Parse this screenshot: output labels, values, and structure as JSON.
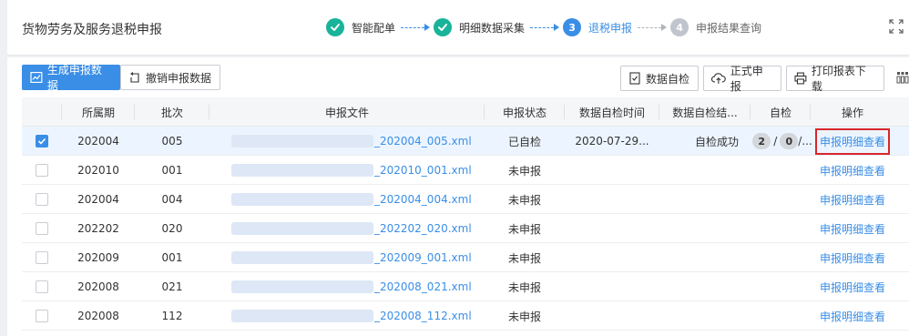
{
  "header": {
    "title": "货物劳务及服务退税申报",
    "steps": [
      {
        "number": "1",
        "label": "智能配单",
        "status": "done"
      },
      {
        "number": "2",
        "label": "明细数据采集",
        "status": "done"
      },
      {
        "number": "3",
        "label": "退税申报",
        "status": "current"
      },
      {
        "number": "4",
        "label": "申报结果查询",
        "status": "todo"
      }
    ]
  },
  "toolbar": {
    "generate_label": "生成申报数据",
    "revoke_label": "撤销申报数据",
    "selfcheck_label": "数据自检",
    "formal_label": "正式申报",
    "print_label": "打印报表下载"
  },
  "table": {
    "columns": [
      "所属期",
      "批次",
      "申报文件",
      "申报状态",
      "数据自检时间",
      "数据自检结...",
      "自检",
      "操作"
    ],
    "rows": [
      {
        "period": "202004",
        "batch": "005",
        "file": "_202004_005.xml",
        "status": "已自检",
        "check_time": "2020-07-29...",
        "check_result": "自检成功",
        "count_a": "2",
        "count_b": "0",
        "count_more": "/...",
        "action": "申报明细查看",
        "selected": true
      },
      {
        "period": "202010",
        "batch": "001",
        "file": "_202010_001.xml",
        "status": "未申报",
        "check_time": "",
        "check_result": "",
        "action": "申报明细查看",
        "selected": false
      },
      {
        "period": "202004",
        "batch": "004",
        "file": "_202004_004.xml",
        "status": "未申报",
        "check_time": "",
        "check_result": "",
        "action": "申报明细查看",
        "selected": false
      },
      {
        "period": "202202",
        "batch": "020",
        "file": "_202202_020.xml",
        "status": "未申报",
        "check_time": "",
        "check_result": "",
        "action": "申报明细查看",
        "selected": false
      },
      {
        "period": "202009",
        "batch": "001",
        "file": "_202009_001.xml",
        "status": "未申报",
        "check_time": "",
        "check_result": "",
        "action": "申报明细查看",
        "selected": false
      },
      {
        "period": "202008",
        "batch": "021",
        "file": "_202008_021.xml",
        "status": "未申报",
        "check_time": "",
        "check_result": "",
        "action": "申报明细查看",
        "selected": false
      },
      {
        "period": "202008",
        "batch": "112",
        "file": "_202008_112.xml",
        "status": "未申报",
        "check_time": "",
        "check_result": "",
        "action": "申报明细查看",
        "selected": false
      }
    ]
  },
  "colors": {
    "accent": "#3a8ee6",
    "done": "#19b39a",
    "highlight_border": "#d9262a"
  }
}
